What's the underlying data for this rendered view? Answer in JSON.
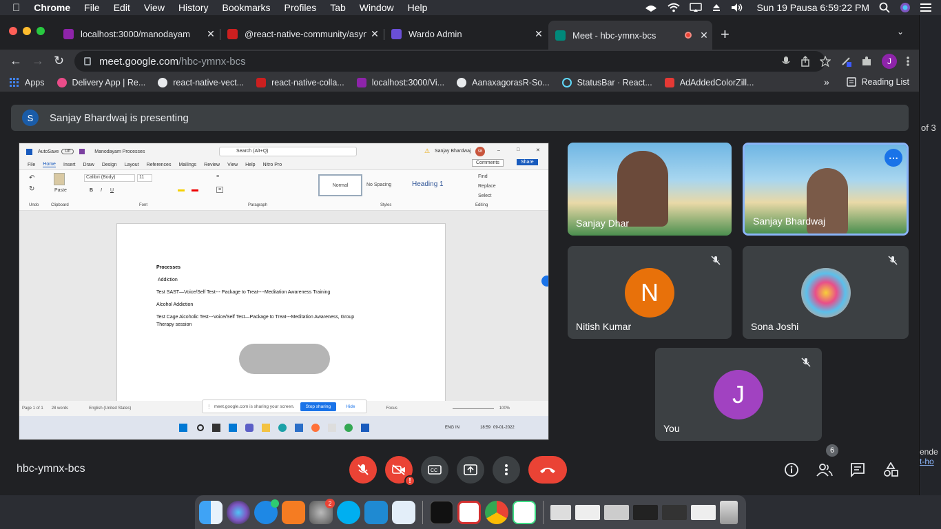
{
  "menubar": {
    "app": "Chrome",
    "items": [
      "File",
      "Edit",
      "View",
      "History",
      "Bookmarks",
      "Profiles",
      "Tab",
      "Window",
      "Help"
    ],
    "datetime": "Sun 19 Pausa  6:59:22 PM"
  },
  "tabs": [
    {
      "title": "localhost:3000/manodayam",
      "color": "#8e24aa"
    },
    {
      "title": "@react-native-community/asyn",
      "color": "#cc1f1f"
    },
    {
      "title": "Wardo Admin",
      "color": "#6a4fd6"
    },
    {
      "title": "Meet - hbc-ymnx-bcs",
      "color": "#00897b"
    }
  ],
  "omnibox": {
    "host": "meet.google.com",
    "path": "/hbc-ymnx-bcs"
  },
  "profile_initial": "J",
  "bookmarks": [
    {
      "label": "Apps",
      "color": "#4285f4"
    },
    {
      "label": "Delivery App | Re...",
      "color": "#ea4c89"
    },
    {
      "label": "react-native-vect...",
      "color": "#e8eaed"
    },
    {
      "label": "react-native-colla...",
      "color": "#cc1f1f"
    },
    {
      "label": "localhost:3000/Vi...",
      "color": "#8e24aa"
    },
    {
      "label": "AanaxagorasR-So...",
      "color": "#e8eaed"
    },
    {
      "label": "StatusBar · React...",
      "color": "#61dafb"
    },
    {
      "label": "AdAddedColorZill...",
      "color": "#e53935"
    }
  ],
  "reading_list": "Reading List",
  "meet": {
    "presenter_initial": "S",
    "presenting_text": "Sanjay Bhardwaj is presenting",
    "meeting_code": "hbc-ymnx-bcs",
    "participants_count": "6",
    "tiles": [
      {
        "name": "Sanjay Dhar"
      },
      {
        "name": "Sanjay Bhardwaj"
      },
      {
        "name": "Nitish Kumar",
        "initial": "N",
        "color": "#e8710a"
      },
      {
        "name": "Sona Joshi"
      },
      {
        "name": "You",
        "initial": "J",
        "color": "#a142c1"
      }
    ]
  },
  "shared_word": {
    "autosave": "AutoSave",
    "autosave_state": "Off",
    "doc_title": "Manodayam Processes",
    "search": "Search (Alt+Q)",
    "user": "Sanjay Bhardwaj",
    "user_initials": "SB",
    "tabs": [
      "File",
      "Home",
      "Insert",
      "Draw",
      "Design",
      "Layout",
      "References",
      "Mailings",
      "Review",
      "View",
      "Help",
      "Nitro Pro"
    ],
    "comments": "Comments",
    "share": "Share",
    "font": "Calibri (Body)",
    "font_size": "11",
    "styles": [
      "Normal",
      "No Spacing",
      "Heading 1"
    ],
    "editing": [
      "Find",
      "Replace",
      "Select"
    ],
    "groups": [
      "Undo",
      "Clipboard",
      "Font",
      "Paragraph",
      "Styles",
      "Editing"
    ],
    "paste": "Paste",
    "lines": [
      "Processes",
      "Addiction",
      "Test SAST—Voice/Self Test--- Package to Treat----Meditation Awareness Training",
      "Alcohol Addiction",
      "Test Cage Alcoholic Test---Voice/Self Test—Package to Treat---Meditation Awareness, Group",
      "Therapy session"
    ],
    "status": {
      "page": "Page 1 of 1",
      "words": "28 words",
      "lang": "English (United States)",
      "focus": "Focus",
      "zoom": "100%"
    },
    "sharing_text": "meet.google.com is sharing your screen.",
    "stop_sharing": "Stop sharing",
    "hide": "Hide",
    "taskbar": {
      "lang": "ENG",
      "region": "IN",
      "time": "18:59",
      "date": "09-01-2022"
    }
  },
  "right_strip": {
    "of3": "of 3",
    "partial1": "ende",
    "partial2": "t-ho"
  },
  "dock": {
    "settings_badge": "2"
  }
}
